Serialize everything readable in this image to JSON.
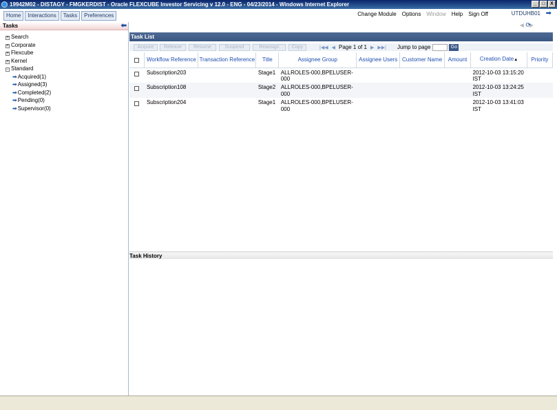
{
  "window": {
    "title": "19942M02 - DISTAGY - FMGKERDIST - Oracle FLEXCUBE Investor Servicing v 12.0 - ENG - 04/23/2014  - Windows Internet Explorer",
    "buttons": {
      "minimize": "_",
      "restore": "□",
      "close": "X"
    }
  },
  "tabs": [
    "Home",
    "Interactions",
    "Tasks",
    "Preferences"
  ],
  "top_menu": {
    "change_module": "Change Module",
    "options": "Options",
    "window": "Window",
    "help": "Help",
    "sign_off": "Sign Off",
    "user": "UTDUHB01"
  },
  "left": {
    "title": "Tasks",
    "tree": [
      {
        "label": "Search",
        "expander": "+"
      },
      {
        "label": "Corporate",
        "expander": "+"
      },
      {
        "label": "Flexcube",
        "expander": "+"
      },
      {
        "label": "Kernel",
        "expander": "+"
      },
      {
        "label": "Standard",
        "expander": "-"
      }
    ],
    "standard_children": [
      "Acquired(1)",
      "Assigned(3)",
      "Completed(2)",
      "Pending(0)",
      "Supervisor(0)"
    ]
  },
  "task_list": {
    "title": "Task List",
    "toolbar_buttons": [
      "Acquire",
      "Release",
      "Resume",
      "Suspend",
      "Reassign",
      "Copy"
    ],
    "pager": {
      "page_label": "Page",
      "page": "1",
      "of_label": "of",
      "total": "1",
      "jump_label": "Jump to page",
      "go": "Go"
    },
    "columns": [
      "Workflow Reference",
      "Transaction Reference",
      "Title",
      "Assignee Group",
      "Assignee Users",
      "Customer Name",
      "Amount",
      "Creation Date",
      "Priority"
    ],
    "rows": [
      {
        "workflow": "Subscription203",
        "txn": "",
        "title": "Stage1",
        "group": "ALLROLES-000,BPELUSER-000",
        "users": "",
        "customer": "",
        "amount": "",
        "date": "2012-10-03 13:15:20 IST",
        "priority": ""
      },
      {
        "workflow": "Subscription108",
        "txn": "",
        "title": "Stage2",
        "group": "ALLROLES-000,BPELUSER-000",
        "users": "",
        "customer": "",
        "amount": "",
        "date": "2012-10-03 13:24:25 IST",
        "priority": ""
      },
      {
        "workflow": "Subscription204",
        "txn": "",
        "title": "Stage1",
        "group": "ALLROLES-000,BPELUSER-000",
        "users": "",
        "customer": "",
        "amount": "",
        "date": "2012-10-03 13:41:03 IST",
        "priority": ""
      }
    ]
  },
  "task_history": {
    "title": "Task History"
  },
  "icons": {
    "collapse": "arrow-left-icon",
    "exit": "arrow-right-icon",
    "refresh": "refresh-icon",
    "tree_arrow": "arrow-right-icon"
  }
}
